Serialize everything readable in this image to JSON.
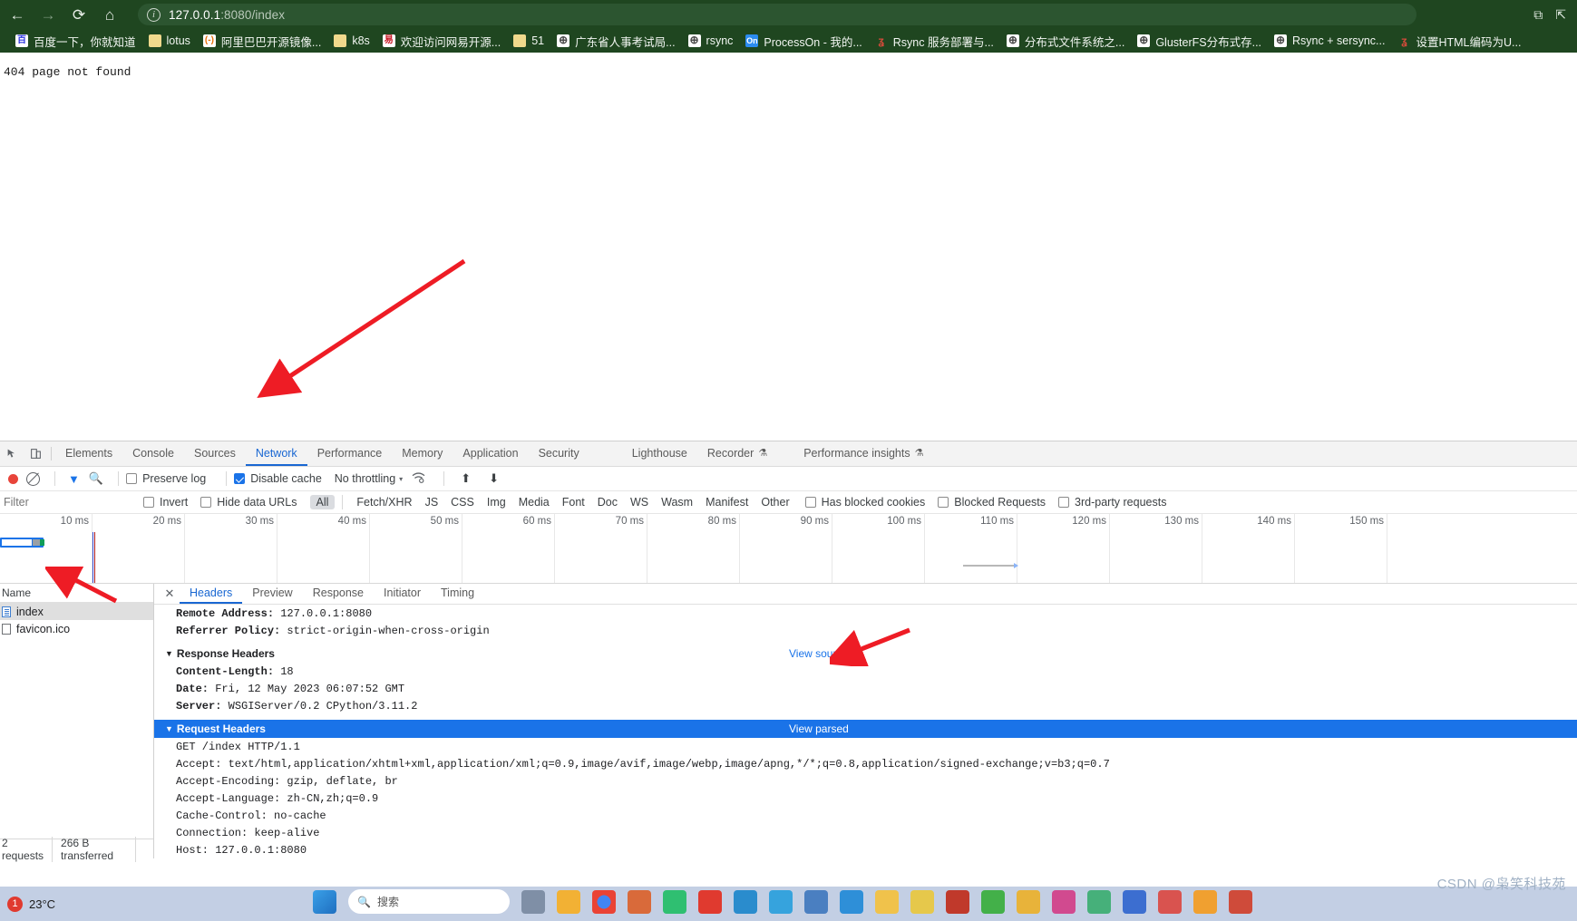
{
  "browser": {
    "nav": {
      "back": "←",
      "forward": "→",
      "reload": "⟳",
      "home": "⌂"
    },
    "omnibox": {
      "info_icon": "i",
      "url_host": "127.0.0.1",
      "url_path": ":8080/index"
    },
    "window_controls": [
      "⧉",
      "⇱"
    ],
    "bookmarks": [
      {
        "label": "百度一下，你就知道",
        "icon": "baidu-icon",
        "icon_text": "百"
      },
      {
        "label": "lotus",
        "icon": "folder-icon",
        "icon_text": ""
      },
      {
        "label": "阿里巴巴开源镜像...",
        "icon": "alibaba-icon",
        "icon_text": "(-)"
      },
      {
        "label": "k8s",
        "icon": "folder-icon",
        "icon_text": ""
      },
      {
        "label": "欢迎访问网易开源...",
        "icon": "netease-icon",
        "icon_text": "易"
      },
      {
        "label": "51",
        "icon": "folder-icon",
        "icon_text": ""
      },
      {
        "label": "广东省人事考试局...",
        "icon": "globe-icon",
        "icon_text": "⊕"
      },
      {
        "label": "rsync",
        "icon": "globe-icon",
        "icon_text": "⊕"
      },
      {
        "label": "ProcessOn - 我的...",
        "icon": "processon-icon",
        "icon_text": "On"
      },
      {
        "label": "Rsync 服务部署与...",
        "icon": "red-icon",
        "icon_text": "ʓ"
      },
      {
        "label": "分布式文件系统之...",
        "icon": "globe-icon",
        "icon_text": "⊕"
      },
      {
        "label": "GlusterFS分布式存...",
        "icon": "globe-icon",
        "icon_text": "⊕"
      },
      {
        "label": "Rsync + sersync...",
        "icon": "globe-icon",
        "icon_text": "⊕"
      },
      {
        "label": "设置HTML编码为U...",
        "icon": "red-icon",
        "icon_text": "ʓ"
      }
    ]
  },
  "page": {
    "body_text": "404 page not found"
  },
  "devtools": {
    "tabs": [
      {
        "label": "Elements",
        "active": false,
        "flask": false
      },
      {
        "label": "Console",
        "active": false,
        "flask": false
      },
      {
        "label": "Sources",
        "active": false,
        "flask": false
      },
      {
        "label": "Network",
        "active": true,
        "flask": false
      },
      {
        "label": "Performance",
        "active": false,
        "flask": false
      },
      {
        "label": "Memory",
        "active": false,
        "flask": false
      },
      {
        "label": "Application",
        "active": false,
        "flask": false
      },
      {
        "label": "Security",
        "active": false,
        "flask": false
      },
      {
        "label": "Lighthouse",
        "active": false,
        "flask": false
      },
      {
        "label": "Recorder",
        "active": false,
        "flask": true
      },
      {
        "label": "Performance insights",
        "active": false,
        "flask": true
      }
    ],
    "toolbar": {
      "record_title": "record-button",
      "clear_title": "clear-button",
      "filter_title": "filter-button",
      "search_title": "search-button",
      "preserve_log": {
        "label": "Preserve log",
        "checked": false
      },
      "disable_cache": {
        "label": "Disable cache",
        "checked": true
      },
      "throttling": "No throttling",
      "caret": "▾",
      "import_title": "import-har",
      "export_title": "export-har"
    },
    "filterbar": {
      "filter_placeholder": "Filter",
      "invert": {
        "label": "Invert",
        "checked": false
      },
      "hide_data_urls": {
        "label": "Hide data URLs",
        "checked": false
      },
      "types": [
        "All",
        "Fetch/XHR",
        "JS",
        "CSS",
        "Img",
        "Media",
        "Font",
        "Doc",
        "WS",
        "Wasm",
        "Manifest",
        "Other"
      ],
      "active_type": "All",
      "has_blocked_cookies": {
        "label": "Has blocked cookies",
        "checked": false
      },
      "blocked_requests": {
        "label": "Blocked Requests",
        "checked": false
      },
      "third_party": {
        "label": "3rd-party requests",
        "checked": false
      }
    },
    "timeline": {
      "ticks": [
        "10 ms",
        "20 ms",
        "30 ms",
        "40 ms",
        "50 ms",
        "60 ms",
        "70 ms",
        "80 ms",
        "90 ms",
        "100 ms",
        "110 ms",
        "120 ms",
        "130 ms",
        "140 ms",
        "150 ms"
      ]
    },
    "requests": {
      "column_header": "Name",
      "rows": [
        {
          "name": "index",
          "selected": true,
          "icon": "document-icon"
        },
        {
          "name": "favicon.ico",
          "selected": false,
          "icon": "file-icon"
        }
      ],
      "status": [
        "2 requests",
        "266 B transferred",
        ""
      ]
    },
    "detail": {
      "close": "✕",
      "tabs": [
        {
          "label": "Headers",
          "active": true
        },
        {
          "label": "Preview",
          "active": false
        },
        {
          "label": "Response",
          "active": false
        },
        {
          "label": "Initiator",
          "active": false
        },
        {
          "label": "Timing",
          "active": false
        }
      ],
      "general_partial": [
        {
          "name": "Remote Address:",
          "value": "127.0.0.1:8080"
        },
        {
          "name": "Referrer Policy:",
          "value": "strict-origin-when-cross-origin"
        }
      ],
      "response_headers": {
        "title": "Response Headers",
        "action": "View source",
        "items": [
          {
            "name": "Content-Length:",
            "value": "18"
          },
          {
            "name": "Date:",
            "value": "Fri, 12 May 2023 06:07:52 GMT"
          },
          {
            "name": "Server:",
            "value": "WSGIServer/0.2 CPython/3.11.2"
          }
        ]
      },
      "request_headers": {
        "title": "Request Headers",
        "action": "View parsed",
        "lines": [
          "GET /index HTTP/1.1",
          "Accept: text/html,application/xhtml+xml,application/xml;q=0.9,image/avif,image/webp,image/apng,*/*;q=0.8,application/signed-exchange;v=b3;q=0.7",
          "Accept-Encoding: gzip, deflate, br",
          "Accept-Language: zh-CN,zh;q=0.9",
          "Cache-Control: no-cache",
          "Connection: keep-alive",
          "Host: 127.0.0.1:8080"
        ]
      }
    }
  },
  "taskbar": {
    "weather_badge": "1",
    "temperature": "23°C",
    "search_placeholder": "搜索"
  },
  "watermark": "CSDN @枭笑科技苑",
  "colors": {
    "chrome_bg": "#1f4620",
    "accent_blue": "#1a73e8",
    "record_red": "#e8443a",
    "annotation_red": "#ee1c25"
  }
}
